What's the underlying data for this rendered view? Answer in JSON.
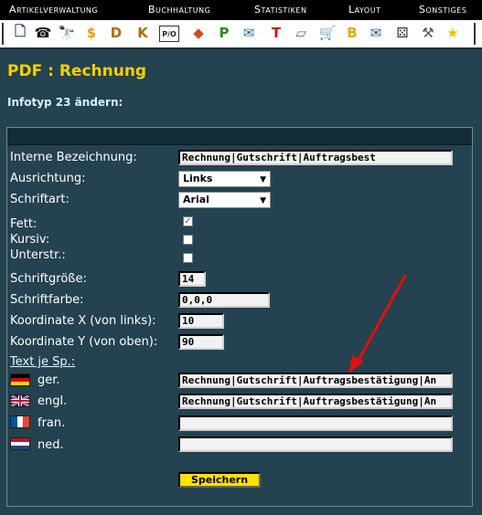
{
  "menu": [
    "Artikelverwaltung",
    "Buchhaltung",
    "Statistiken",
    "Layout",
    "Sonstiges"
  ],
  "toolbar": {
    "icons": [
      {
        "name": "new-document-icon",
        "glyph": "🗋",
        "color": "#1a3b8c"
      },
      {
        "name": "phone-icon",
        "glyph": "☎",
        "color": "#111"
      },
      {
        "name": "binoculars-icon",
        "glyph": "🔭",
        "color": "#111"
      },
      {
        "name": "dollar-icon",
        "glyph": "$",
        "color": "#e8a000"
      },
      {
        "name": "customer-d-icon",
        "glyph": "D",
        "color": "#b36b00"
      },
      {
        "name": "customer-k-icon",
        "glyph": "K",
        "color": "#b36b00"
      },
      {
        "name": "pio-icon",
        "glyph": "P/O",
        "color": "#222"
      },
      {
        "name": "boxes-icon",
        "glyph": "◆",
        "color": "#d24a1a"
      },
      {
        "name": "p-icon",
        "glyph": "P",
        "color": "#2a8a1a"
      },
      {
        "name": "mail-edit-icon",
        "glyph": "✉",
        "color": "#2a6ab0"
      },
      {
        "name": "t-icon",
        "glyph": "T",
        "color": "#d01010"
      },
      {
        "name": "eraser-icon",
        "glyph": "▱",
        "color": "#666"
      },
      {
        "name": "cart-icon",
        "glyph": "🛒",
        "color": "#444"
      },
      {
        "name": "b-icon",
        "glyph": "B",
        "color": "#e6a800"
      },
      {
        "name": "newsletter-icon",
        "glyph": "✉",
        "color": "#3355aa"
      },
      {
        "name": "dice-icon",
        "glyph": "⚄",
        "color": "#333"
      },
      {
        "name": "hammer-icon",
        "glyph": "⚒",
        "color": "#555"
      },
      {
        "name": "star-icon",
        "glyph": "★",
        "color": "#f0c000"
      }
    ]
  },
  "page_title": "PDF : Rechnung",
  "subtitle": "Infotyp 23 ändern:",
  "form": {
    "interne_bezeichnung_label": "Interne Bezeichnung:",
    "interne_bezeichnung_value": "Rechnung|Gutschrift|Auftragsbest",
    "ausrichtung_label": "Ausrichtung:",
    "ausrichtung_value": "Links",
    "schriftart_label": "Schriftart:",
    "schriftart_value": "Arial",
    "fett_label": "Fett:",
    "fett_checked": true,
    "kursiv_label": "Kursiv:",
    "kursiv_checked": false,
    "unterstr_label": "Unterstr.:",
    "unterstr_checked": false,
    "schriftgroesse_label": "Schriftgröße:",
    "schriftgroesse_value": "14",
    "schriftfarbe_label": "Schriftfarbe:",
    "schriftfarbe_value": "0,0,0",
    "koord_x_label": "Koordinate X (von links):",
    "koord_x_value": "10",
    "koord_y_label": "Koordinate Y (von oben):",
    "koord_y_value": "90",
    "text_je_sp_label": "Text je Sp.:",
    "languages": [
      {
        "label": "ger.",
        "value": "Rechnung|Gutschrift|Auftragsbestätigung|An"
      },
      {
        "label": "engl.",
        "value": "Rechnung|Gutschrift|Auftragsbestätigung|An"
      },
      {
        "label": "fran.",
        "value": ""
      },
      {
        "label": "ned.",
        "value": ""
      }
    ],
    "save_label": "Speichern"
  },
  "colors": {
    "background": "#24424f",
    "title": "#f5d000",
    "button": "#ffe000",
    "arrow": "#e01010"
  }
}
